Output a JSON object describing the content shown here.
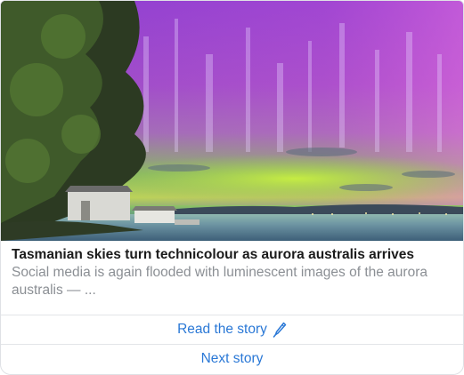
{
  "story": {
    "image_alt": "Aurora australis over a Tasmanian waterfront with boathouses",
    "headline": "Tasmanian skies turn technicolour as aurora australis arrives",
    "summary": "Social media is again flooded with luminescent images of the aurora australis — ..."
  },
  "actions": {
    "read_label": "Read the story",
    "read_icon": "pen-icon",
    "next_label": "Next story"
  },
  "colors": {
    "link": "#2a78d6",
    "headline": "#1b1b1b",
    "summary": "#8b8f94",
    "divider": "#e3e5e8"
  }
}
